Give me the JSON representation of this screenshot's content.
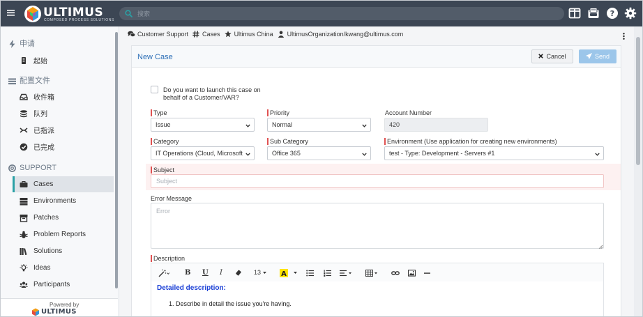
{
  "brand": {
    "name": "ULTIMUS",
    "tagline": "COMPOSED PROCESS SOLUTIONS",
    "colors": {
      "topbar": "#3c4654",
      "accent": "#2aa1a6",
      "link": "#2d6fb7",
      "required": "#e05252"
    }
  },
  "search": {
    "placeholder": "搜索"
  },
  "top_icons": [
    "layout-icon",
    "inbox-icon",
    "help-icon",
    "settings-icon"
  ],
  "sidebar": {
    "sections": [
      {
        "label": "申请",
        "icon": "bolt-icon",
        "items": [
          {
            "label": "起始",
            "icon": "file-icon"
          }
        ]
      },
      {
        "label": "配置文件",
        "icon": "list-icon",
        "items": [
          {
            "label": "收件箱",
            "icon": "inbox-icon"
          },
          {
            "label": "队列",
            "icon": "stack-icon"
          },
          {
            "label": "已指派",
            "icon": "assign-icon"
          },
          {
            "label": "已完成",
            "icon": "check-circle-icon"
          }
        ]
      },
      {
        "label": "SUPPORT",
        "icon": "support-icon",
        "items": [
          {
            "label": "Cases",
            "icon": "case-icon",
            "active": true
          },
          {
            "label": "Environments",
            "icon": "server-icon"
          },
          {
            "label": "Patches",
            "icon": "patch-icon"
          },
          {
            "label": "Problem Reports",
            "icon": "bug-icon"
          },
          {
            "label": "Solutions",
            "icon": "book-icon"
          },
          {
            "label": "Ideas",
            "icon": "bulb-icon"
          },
          {
            "label": "Participants",
            "icon": "users-icon"
          }
        ]
      }
    ],
    "powered_by": "Powered by",
    "powered_brand": "ULTIMUS"
  },
  "breadcrumb": [
    {
      "label": "Customer Support",
      "icon": "comments-icon"
    },
    {
      "label": "Cases",
      "icon": "hashtag-icon"
    },
    {
      "label": "Ultimus China",
      "icon": "star-icon"
    },
    {
      "label": "UltimusOrganization/kwang@ultimus.com",
      "icon": "user-icon"
    }
  ],
  "form": {
    "title": "New Case",
    "cancel_label": "Cancel",
    "send_label": "Send",
    "behalf_label": "Do you want to launch this case on behalf of a Customer/VAR?",
    "behalf_checked": false,
    "type": {
      "label": "Type",
      "value": "Issue"
    },
    "priority": {
      "label": "Priority",
      "value": "Normal"
    },
    "account": {
      "label": "Account Number",
      "value": "420"
    },
    "category": {
      "label": "Category",
      "value": "IT Operations (Cloud, Microsoft"
    },
    "sub_category": {
      "label": "Sub Category",
      "value": "Office 365"
    },
    "environment": {
      "label": "Environment (Use application for creating new environments)",
      "value": "test - Type: Development - Servers #1"
    },
    "subject": {
      "label": "Subject",
      "placeholder": "Subject",
      "value": ""
    },
    "error": {
      "label": "Error Message",
      "placeholder": "Error",
      "value": ""
    },
    "description": {
      "label": "Description",
      "toolbar": {
        "font_size": "13"
      },
      "heading": "Detailed description:",
      "items": [
        "Describe in detail the issue you're having."
      ]
    }
  }
}
